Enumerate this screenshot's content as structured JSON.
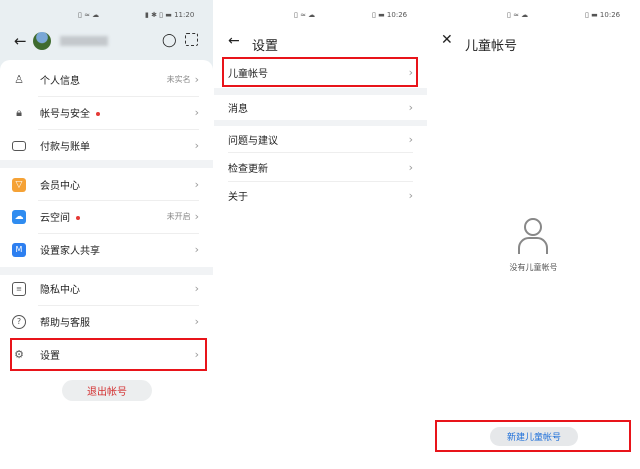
{
  "panel1": {
    "status_time": "11:20",
    "username": "····",
    "items": [
      {
        "label": "个人信息",
        "value": "未实名",
        "icon": "person-icon"
      },
      {
        "label": "帐号与安全",
        "dot": true,
        "icon": "lock-icon"
      },
      {
        "label": "付款与账单",
        "icon": "card-icon"
      },
      {
        "label": "会员中心",
        "icon": "vip-icon"
      },
      {
        "label": "云空间",
        "dot": true,
        "value": "未开启",
        "icon": "cloud-icon"
      },
      {
        "label": "设置家人共享",
        "icon": "family-icon"
      },
      {
        "label": "隐私中心",
        "icon": "privacy-icon"
      },
      {
        "label": "帮助与客服",
        "icon": "help-icon"
      },
      {
        "label": "设置",
        "icon": "gear-icon"
      }
    ],
    "logout": "退出帐号"
  },
  "panel2": {
    "status_time": "10:26",
    "title": "设置",
    "items": [
      "儿童帐号",
      "消息",
      "问题与建议",
      "检查更新",
      "关于"
    ]
  },
  "panel3": {
    "status_time": "10:26",
    "title": "儿童帐号",
    "empty_text": "没有儿童帐号",
    "create_button": "新建儿童帐号"
  },
  "colors": {
    "highlight": "#e8141a",
    "logout_text": "#d32f2f",
    "link_blue": "#1e6fd9"
  }
}
